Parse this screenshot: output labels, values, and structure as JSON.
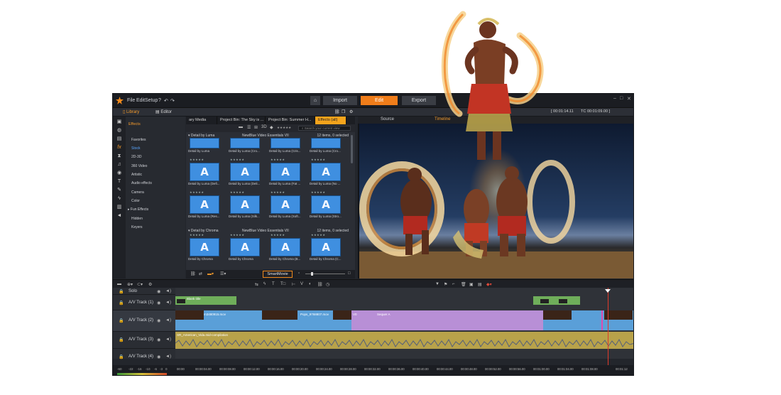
{
  "menu": {
    "file": "File",
    "edit": "Edit",
    "setup": "Setup"
  },
  "nav": {
    "import": "Import",
    "edit": "Edit",
    "export": "Export",
    "home_icon": "home-icon"
  },
  "library_tabs": {
    "library": "Library",
    "editor": "Editor"
  },
  "categories": [
    "Effects",
    "Favorites",
    "Stock",
    "2D-3D",
    "360 Video",
    "Artistic",
    "Audio effects",
    "Camera",
    "Color",
    "Fun Effects",
    "Hidden",
    "Keyers"
  ],
  "bins": [
    "ary Media",
    "Project Bin: The Sky is ...",
    "Project Bin: Summer H...",
    "Effects (all)"
  ],
  "search": {
    "placeholder": "Search your current view"
  },
  "groups": [
    {
      "name": "Detail by Luma",
      "mid": "NewBlue Video Essentials VII",
      "right": "12 items, 0 selected"
    },
    {
      "name": "Detail by Chroma",
      "mid": "NewBlue Video Essentials VII",
      "right": "12 items, 0 selected"
    }
  ],
  "row0_labels": [
    "Detail by Luma",
    "Detail by Luma (Cro...",
    "Detail by Luma (Cris...",
    "Detail by Luma (Cro..."
  ],
  "row1_labels": [
    "Detail by Luma (Defi...",
    "Detail by Luma (Deli...",
    "Detail by Luma (Fat ...",
    "Detail by Luma (No ..."
  ],
  "row2_labels": [
    "Detail by Luma (Res...",
    "Detail by Luma (Silk...",
    "Detail by Luma (Soft...",
    "Detail by Luma (Stro..."
  ],
  "row3_labels": [
    "Detail by Chroma",
    "Detail by Chroma",
    "Detail by Chroma (B...",
    "Detail by Chroma (C..."
  ],
  "tile_glyph": "A",
  "stars": "★★★★★",
  "smartmovie": "SmartMovie",
  "preview": {
    "source": "Source",
    "timeline": "Timeline",
    "tc_left": "[ 00:01:14.11",
    "tc_label": "TC",
    "tc_right": "00:01:09.00 ]"
  },
  "tracks": [
    {
      "name": "Solo"
    },
    {
      "name": "A/V Track (1)"
    },
    {
      "name": "A/V Track (2)"
    },
    {
      "name": "A/V Track (3)"
    },
    {
      "name": "A/V Track (4)"
    }
  ],
  "clips": {
    "blank_title": "Blank title",
    "clip_a": "m3480915.mov",
    "clip_b": "Pops_9768807.mov",
    "clip_c": "Sequer A",
    "clip_c_prefix": "V0",
    "audio": "SR_American_Vida.mid-compilation"
  },
  "ruler": [
    "00:00",
    "00:00:04.00",
    "00:00:08.00",
    "00:00:12.00",
    "00:00:16.00",
    "00:00:20.00",
    "00:00:24.00",
    "00:00:28.00",
    "00:00:32.00",
    "00:00:36.00",
    "00:00:40.00",
    "00:00:44.00",
    "00:00:48.00",
    "00:00:52.00",
    "00:00:56.00",
    "00:01:00.00",
    "00:01:04.00",
    "00:01:08.00",
    "00:01:12"
  ],
  "levels": [
    "-60",
    "-22",
    "-16",
    "-10",
    "-6",
    "-3",
    "0"
  ],
  "colors": {
    "accent": "#f07d1a",
    "tile_blue": "#3f8fe0",
    "video_clip": "#5a9fd8",
    "purple_clip": "#b88fd6",
    "audio_clip": "#b8a24a",
    "title_clip": "#6fae5a"
  }
}
